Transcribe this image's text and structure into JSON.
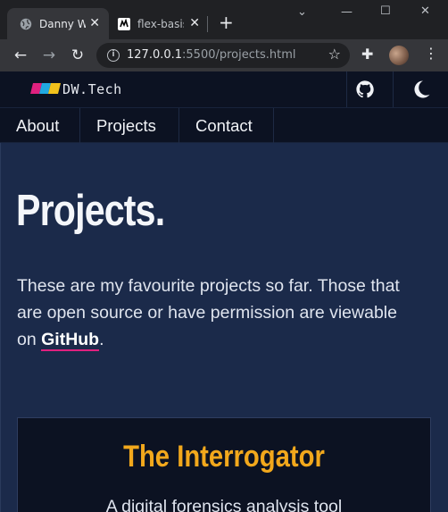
{
  "browser": {
    "tabs": [
      {
        "title": "Danny W",
        "active": true
      },
      {
        "title": "flex-basis",
        "active": false
      }
    ],
    "new_tab_label": "+",
    "url_host": "127.0.0.1",
    "url_rest": ":5500/projects.html"
  },
  "site": {
    "logo_text": "DW.Tech",
    "logo_colors": [
      "#e0217f",
      "#21a9e1",
      "#f2c21c"
    ],
    "nav": [
      "About",
      "Projects",
      "Contact"
    ]
  },
  "page": {
    "title": "Projects.",
    "intro_before": "These are my favourite projects so far. Those that are open source or have permission are viewable on ",
    "intro_link": "GitHub",
    "intro_after": "."
  },
  "project": {
    "title": "The Interrogator",
    "description": "A digital forensics analysis tool"
  },
  "colors": {
    "accent": "#f2a81c",
    "link_underline": "#e0217f",
    "background": "#1b2a4a",
    "header": "#0c1222"
  }
}
